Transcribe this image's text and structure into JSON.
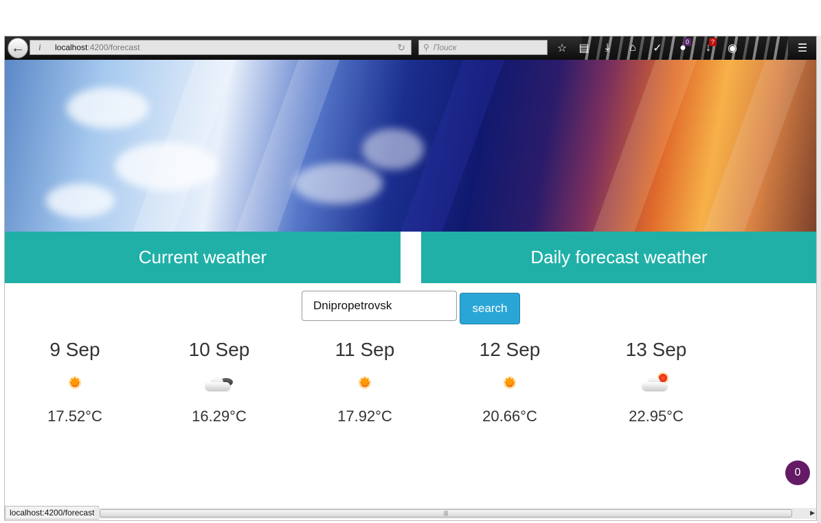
{
  "browser": {
    "url_host": "localhost",
    "url_path": ":4200/forecast",
    "search_placeholder": "Поиск",
    "status_text": "localhost:4200/forecast",
    "badges": [
      "0",
      "?"
    ]
  },
  "tabs": {
    "current": "Current weather",
    "daily": "Daily forecast weather"
  },
  "search": {
    "city_value": "Dnipropetrovsk",
    "button_label": "search"
  },
  "forecast": [
    {
      "date": "9 Sep",
      "icon": "sun-icon",
      "temp": "17.52°C"
    },
    {
      "date": "10 Sep",
      "icon": "cloud-icon",
      "temp": "16.29°C"
    },
    {
      "date": "11 Sep",
      "icon": "sun-icon",
      "temp": "17.92°C"
    },
    {
      "date": "12 Sep",
      "icon": "sun-icon",
      "temp": "20.66°C"
    },
    {
      "date": "13 Sep",
      "icon": "cloud-sun-icon",
      "temp": "22.95°C"
    }
  ],
  "fab_count": "0",
  "colors": {
    "tab_bg": "#20b0a8",
    "button_bg": "#2aa6d6",
    "fab_bg": "#641a64"
  }
}
